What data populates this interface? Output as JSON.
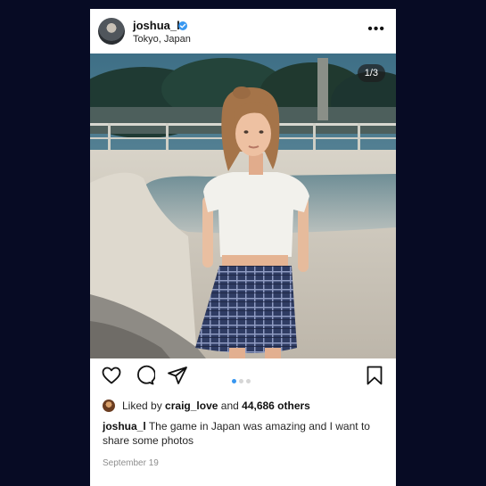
{
  "post": {
    "username": "joshua_l",
    "location": "Tokyo, Japan",
    "more_label": "•••",
    "photo_counter": "1/3",
    "carousel": {
      "total": 3,
      "active_index": 0
    },
    "likes": {
      "prefix": "Liked by",
      "user": "craig_love",
      "conjunction": "and",
      "count": "44,686 others"
    },
    "caption": {
      "username": "joshua_l",
      "text": "The game in Japan was amazing and I want to share some photos"
    },
    "date": "September 19"
  },
  "colors": {
    "background": "#070b24",
    "card": "#ffffff",
    "verified": "#3897f0",
    "active_dot": "#3897f0"
  },
  "icons": [
    "verified-badge-icon",
    "more-options-icon",
    "heart-icon",
    "comment-icon",
    "share-icon",
    "bookmark-icon"
  ]
}
